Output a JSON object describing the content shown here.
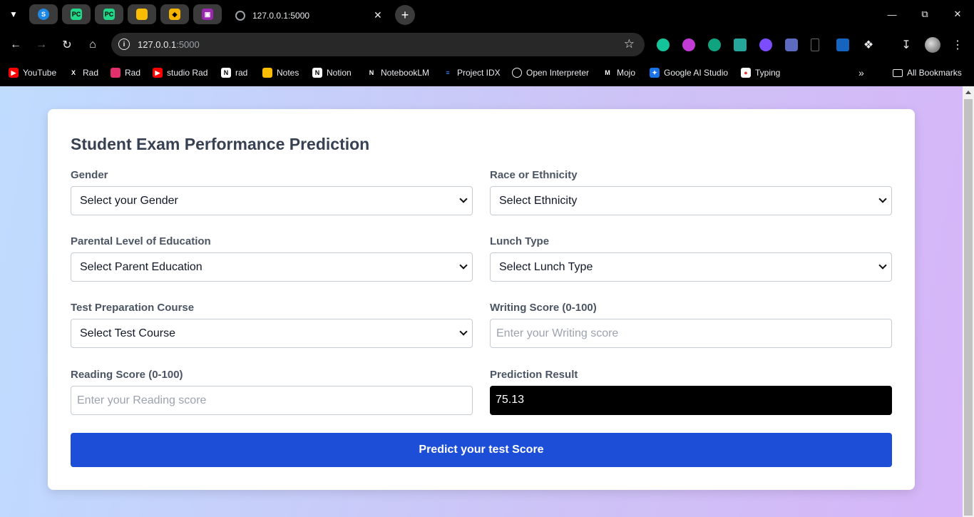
{
  "browser": {
    "tab": {
      "title": "127.0.0.1:5000"
    },
    "url": {
      "host": "127.0.0.1",
      "port": ":5000"
    },
    "pinned_tabs": [
      {
        "icon": "s-logo-icon",
        "color": "#1e88e5"
      },
      {
        "icon": "pycharm-icon",
        "color": "#21d789"
      },
      {
        "icon": "pycharm-icon",
        "color": "#21d789"
      },
      {
        "icon": "keep-icon",
        "color": "#fbbc04"
      },
      {
        "icon": "stack-icon",
        "color": "#f4b400"
      },
      {
        "icon": "app-icon",
        "color": "#9c27b0"
      }
    ],
    "bookmarks": [
      {
        "label": "YouTube",
        "icon": "youtube-icon",
        "color": "#ff0000"
      },
      {
        "label": "Rad",
        "icon": "x-icon",
        "color": "#000000"
      },
      {
        "label": "Rad",
        "icon": "instagram-icon",
        "color": "#e1306c"
      },
      {
        "label": "studio Rad",
        "icon": "youtube-studio-icon",
        "color": "#ff0000"
      },
      {
        "label": "rad",
        "icon": "notion-icon",
        "color": "#ffffff"
      },
      {
        "label": "Notes",
        "icon": "keep-icon",
        "color": "#fbbc04"
      },
      {
        "label": "Notion",
        "icon": "notion-icon",
        "color": "#ffffff"
      },
      {
        "label": "NotebookLM",
        "icon": "notebooklm-icon",
        "color": "#000000"
      },
      {
        "label": "Project IDX",
        "icon": "idx-icon",
        "color": "#4285f4"
      },
      {
        "label": "Open Interpreter",
        "icon": "circle-icon",
        "color": "#000000"
      },
      {
        "label": "Mojo",
        "icon": "mojo-icon",
        "color": "#000000"
      },
      {
        "label": "Google AI Studio",
        "icon": "ai-studio-icon",
        "color": "#1a73e8"
      },
      {
        "label": "Typing",
        "icon": "typing-icon",
        "color": "#e53935"
      }
    ],
    "all_bookmarks": "All Bookmarks"
  },
  "form": {
    "title": "Student Exam Performance Prediction",
    "gender": {
      "label": "Gender",
      "value": "Select your Gender"
    },
    "ethnicity": {
      "label": "Race or Ethnicity",
      "value": "Select Ethnicity"
    },
    "parent_education": {
      "label": "Parental Level of Education",
      "value": "Select Parent Education"
    },
    "lunch": {
      "label": "Lunch Type",
      "value": "Select Lunch Type"
    },
    "test_course": {
      "label": "Test Preparation Course",
      "value": "Select Test Course"
    },
    "writing": {
      "label": "Writing Score (0-100)",
      "placeholder": "Enter your Writing score"
    },
    "reading": {
      "label": "Reading Score (0-100)",
      "placeholder": "Enter your Reading score"
    },
    "result": {
      "label": "Prediction Result",
      "value": "75.13"
    },
    "submit_label": "Predict your test Score"
  },
  "colors": {
    "accent": "#1d4ed8",
    "result_bg": "#000000"
  }
}
